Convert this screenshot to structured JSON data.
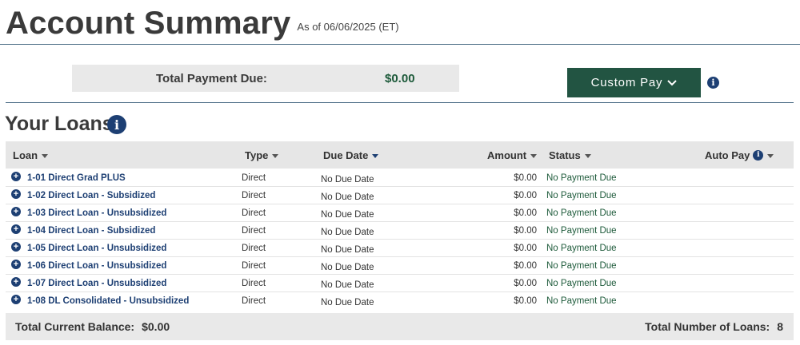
{
  "header": {
    "title": "Account Summary",
    "as_of": "As of 06/06/2025 (ET)"
  },
  "payment": {
    "label": "Total Payment Due:",
    "amount": "$0.00",
    "custom_pay_label": "Custom Pay",
    "info_icon": "info-icon"
  },
  "loans_section": {
    "title": "Your Loans",
    "info_icon": "info-icon",
    "columns": {
      "loan": "Loan",
      "type": "Type",
      "due_date": "Due Date",
      "amount": "Amount",
      "status": "Status",
      "auto_pay": "Auto Pay"
    },
    "rows": [
      {
        "loan": "1-01 Direct Grad PLUS",
        "type": "Direct",
        "due_date": "No Due Date",
        "amount": "$0.00",
        "status": "No Payment Due"
      },
      {
        "loan": "1-02 Direct Loan - Subsidized",
        "type": "Direct",
        "due_date": "No Due Date",
        "amount": "$0.00",
        "status": "No Payment Due"
      },
      {
        "loan": "1-03 Direct Loan - Unsubsidized",
        "type": "Direct",
        "due_date": "No Due Date",
        "amount": "$0.00",
        "status": "No Payment Due"
      },
      {
        "loan": "1-04 Direct Loan - Subsidized",
        "type": "Direct",
        "due_date": "No Due Date",
        "amount": "$0.00",
        "status": "No Payment Due"
      },
      {
        "loan": "1-05 Direct Loan - Unsubsidized",
        "type": "Direct",
        "due_date": "No Due Date",
        "amount": "$0.00",
        "status": "No Payment Due"
      },
      {
        "loan": "1-06 Direct Loan - Unsubsidized",
        "type": "Direct",
        "due_date": "No Due Date",
        "amount": "$0.00",
        "status": "No Payment Due"
      },
      {
        "loan": "1-07 Direct Loan - Unsubsidized",
        "type": "Direct",
        "due_date": "No Due Date",
        "amount": "$0.00",
        "status": "No Payment Due"
      },
      {
        "loan": "1-08 DL Consolidated - Unsubsidized",
        "type": "Direct",
        "due_date": "No Due Date",
        "amount": "$0.00",
        "status": "No Payment Due"
      }
    ],
    "footer": {
      "balance_label": "Total Current Balance:",
      "balance_value": "$0.00",
      "count_label": "Total Number of Loans:",
      "count_value": "8"
    }
  },
  "colors": {
    "accent_green": "#225442",
    "link_blue": "#1d3f73",
    "status_green": "#1d5a3a"
  }
}
